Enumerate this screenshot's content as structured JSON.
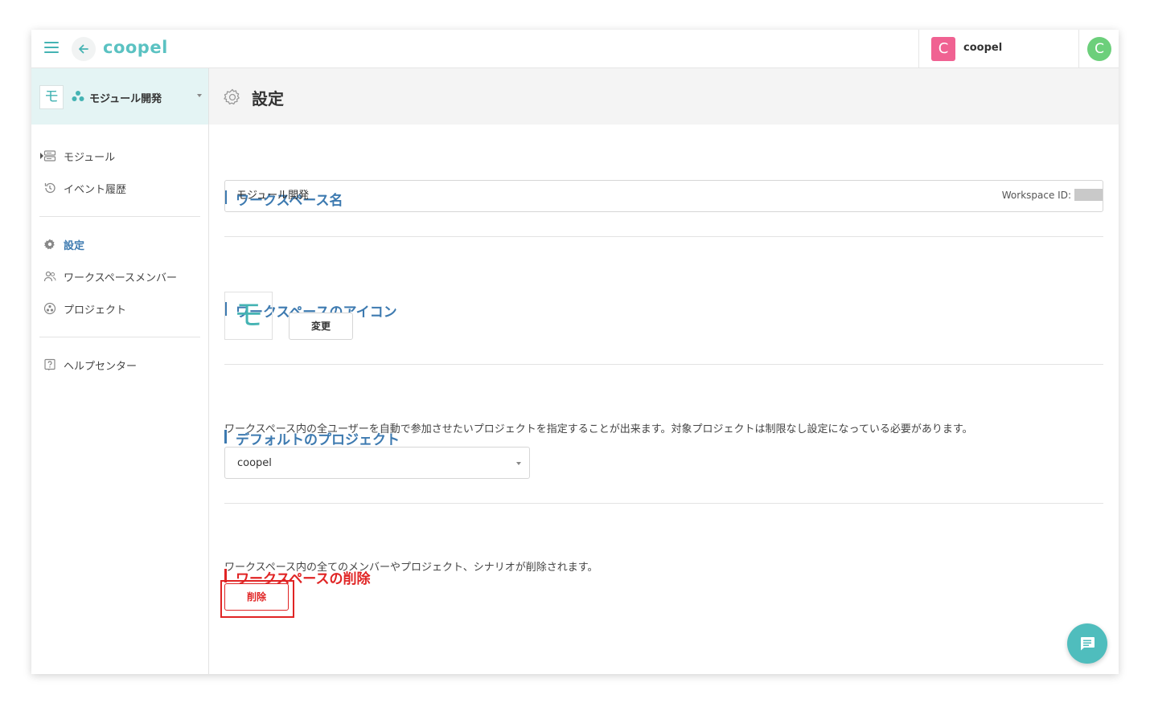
{
  "app": {
    "logo_text": "coopel",
    "brand_color": "#44b3b3"
  },
  "topbar": {
    "user_initial": "C",
    "user_name": "coopel",
    "avatar_initial": "C"
  },
  "sidebar": {
    "workspace_icon_char": "モ",
    "workspace_name": "モジュール開発",
    "items": [
      {
        "label": "モジュール",
        "icon": "server-icon"
      },
      {
        "label": "イベント履歴",
        "icon": "history-icon"
      },
      {
        "label": "設定",
        "icon": "gear-icon",
        "active": true
      },
      {
        "label": "ワークスペースメンバー",
        "icon": "users-icon"
      },
      {
        "label": "プロジェクト",
        "icon": "project-icon"
      },
      {
        "label": "ヘルプセンター",
        "icon": "help-icon"
      }
    ]
  },
  "page": {
    "title": "設定",
    "workspace_id_label": "Workspace ID:",
    "sections": {
      "name": {
        "title": "ワークスペース名",
        "value": "モジュール開発"
      },
      "icon": {
        "title": "ワークスペースのアイコン",
        "icon_char": "モ",
        "change_label": "変更"
      },
      "default_project": {
        "title": "デフォルトのプロジェクト",
        "description": "ワークスペース内の全ユーザーを自動で参加させたいプロジェクトを指定することが出来ます。対象プロジェクトは制限なし設定になっている必要があります。",
        "selected": "coopel"
      },
      "delete": {
        "title": "ワークスペースの削除",
        "description": "ワークスペース内の全てのメンバーやプロジェクト、シナリオが削除されます。",
        "button_label": "削除"
      }
    }
  },
  "colors": {
    "accent": "#3d7ab0",
    "danger": "#e02424",
    "user_badge": "#f06292",
    "avatar": "#6ccf7b",
    "fab": "#4fbdbd"
  }
}
